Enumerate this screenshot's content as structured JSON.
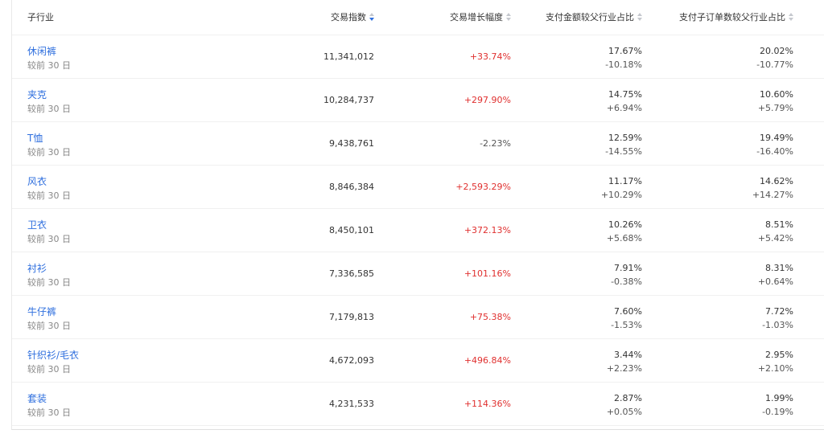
{
  "table": {
    "headers": [
      "子行业",
      "交易指数",
      "交易增长幅度",
      "支付金额较父行业占比",
      "支付子订单数较父行业占比"
    ],
    "sort_active_column": 1,
    "rows": [
      {
        "name": "休闲裤",
        "sub": "较前 30 日",
        "index": "11,341,012",
        "growth": "+33.74%",
        "growth_sign": "pos",
        "pay_share": "17.67%",
        "pay_delta": "-10.18%",
        "order_share": "20.02%",
        "order_delta": "-10.77%"
      },
      {
        "name": "夹克",
        "sub": "较前 30 日",
        "index": "10,284,737",
        "growth": "+297.90%",
        "growth_sign": "pos",
        "pay_share": "14.75%",
        "pay_delta": "+6.94%",
        "order_share": "10.60%",
        "order_delta": "+5.79%"
      },
      {
        "name": "T恤",
        "sub": "较前 30 日",
        "index": "9,438,761",
        "growth": "-2.23%",
        "growth_sign": "neg",
        "pay_share": "12.59%",
        "pay_delta": "-14.55%",
        "order_share": "19.49%",
        "order_delta": "-16.40%"
      },
      {
        "name": "风衣",
        "sub": "较前 30 日",
        "index": "8,846,384",
        "growth": "+2,593.29%",
        "growth_sign": "pos",
        "pay_share": "11.17%",
        "pay_delta": "+10.29%",
        "order_share": "14.62%",
        "order_delta": "+14.27%"
      },
      {
        "name": "卫衣",
        "sub": "较前 30 日",
        "index": "8,450,101",
        "growth": "+372.13%",
        "growth_sign": "pos",
        "pay_share": "10.26%",
        "pay_delta": "+5.68%",
        "order_share": "8.51%",
        "order_delta": "+5.42%"
      },
      {
        "name": "衬衫",
        "sub": "较前 30 日",
        "index": "7,336,585",
        "growth": "+101.16%",
        "growth_sign": "pos",
        "pay_share": "7.91%",
        "pay_delta": "-0.38%",
        "order_share": "8.31%",
        "order_delta": "+0.64%"
      },
      {
        "name": "牛仔裤",
        "sub": "较前 30 日",
        "index": "7,179,813",
        "growth": "+75.38%",
        "growth_sign": "pos",
        "pay_share": "7.60%",
        "pay_delta": "-1.53%",
        "order_share": "7.72%",
        "order_delta": "-1.03%"
      },
      {
        "name": "针织衫/毛衣",
        "sub": "较前 30 日",
        "index": "4,672,093",
        "growth": "+496.84%",
        "growth_sign": "pos",
        "pay_share": "3.44%",
        "pay_delta": "+2.23%",
        "order_share": "2.95%",
        "order_delta": "+2.10%"
      },
      {
        "name": "套装",
        "sub": "较前 30 日",
        "index": "4,231,533",
        "growth": "+114.36%",
        "growth_sign": "pos",
        "pay_share": "2.87%",
        "pay_delta": "+0.05%",
        "order_share": "1.99%",
        "order_delta": "-0.19%"
      }
    ]
  }
}
